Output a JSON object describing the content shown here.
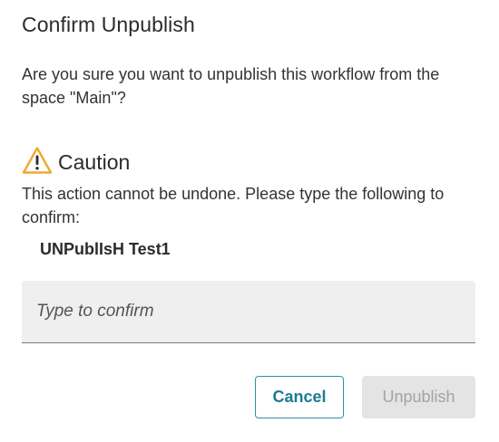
{
  "dialog": {
    "title": "Confirm Unpublish",
    "question": "Are you sure you want to unpublish this workflow from the space \"Main\"?",
    "caution": {
      "icon": "warning-icon",
      "title": "Caution",
      "text": "This action cannot be undone. Please type the following to confirm:",
      "phrase": "UNPublIsH Test1"
    },
    "input": {
      "value": "",
      "placeholder": "Type to confirm"
    },
    "buttons": {
      "cancel_label": "Cancel",
      "unpublish_label": "Unpublish",
      "unpublish_disabled": true
    },
    "colors": {
      "accent": "#1c7b94",
      "warning": "#f0a733",
      "disabled_bg": "#e4e4e4",
      "disabled_text": "#a3a3a3"
    }
  }
}
